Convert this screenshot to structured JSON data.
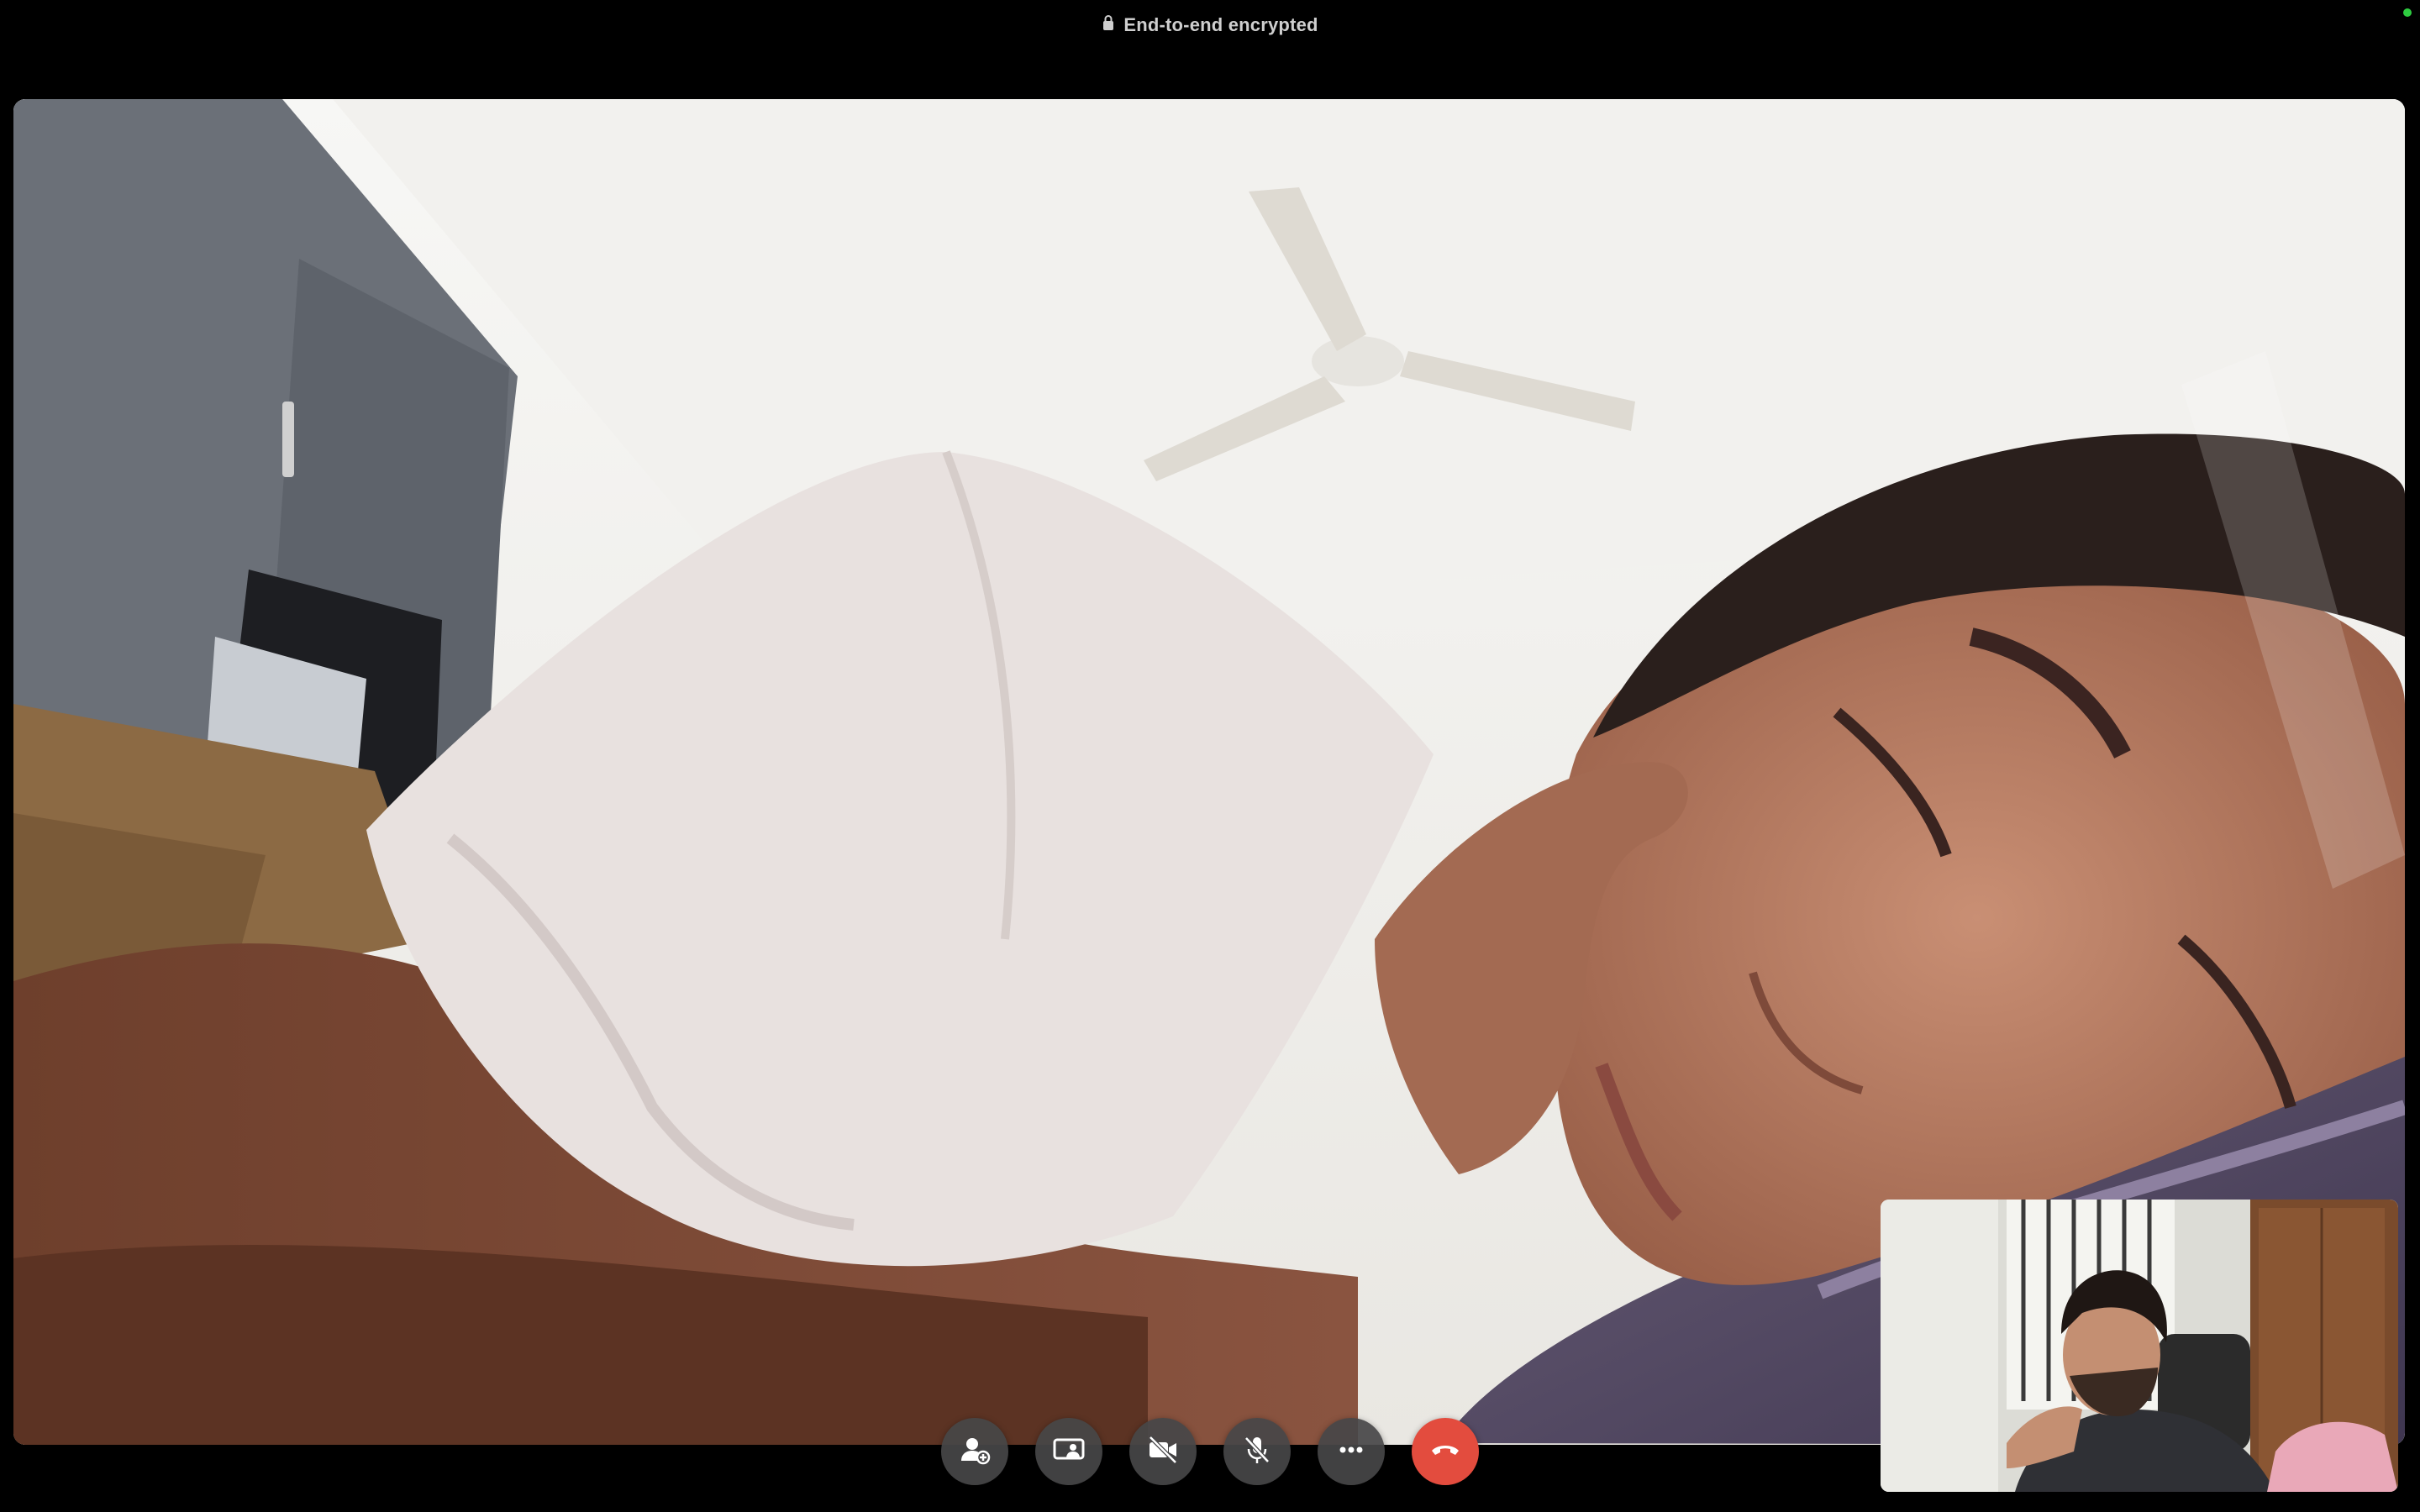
{
  "header": {
    "encryption_label": "End-to-end encrypted",
    "lock_icon": "lock-icon"
  },
  "call": {
    "remote_video": "remote-participant-video",
    "self_view": "self-view-video",
    "status_color": "#2ecc40"
  },
  "controls": [
    {
      "name": "add-participant-button",
      "icon": "add-person-icon"
    },
    {
      "name": "share-screen-button",
      "icon": "screen-share-icon"
    },
    {
      "name": "video-toggle-button",
      "icon": "video-off-icon"
    },
    {
      "name": "mic-toggle-button",
      "icon": "mic-off-icon"
    },
    {
      "name": "more-options-button",
      "icon": "ellipsis-icon"
    },
    {
      "name": "end-call-button",
      "icon": "phone-hangup-icon",
      "color": "#e34c3e"
    }
  ]
}
